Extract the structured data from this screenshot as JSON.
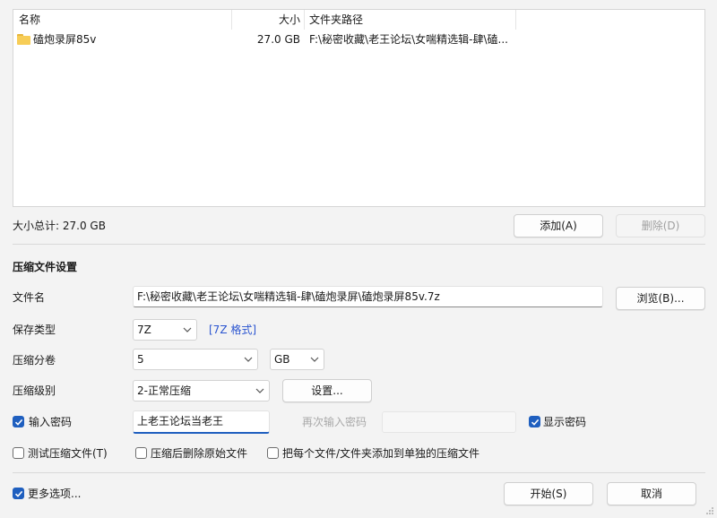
{
  "file_list": {
    "columns": {
      "name": "名称",
      "size": "大小",
      "path": "文件夹路径"
    },
    "rows": [
      {
        "icon": "folder-icon",
        "name": "磕炮录屏85v",
        "size": "27.0 GB",
        "path": "F:\\秘密收藏\\老王论坛\\女喘精选辑-肆\\磕..."
      }
    ]
  },
  "summary": {
    "total_size": "大小总计: 27.0 GB"
  },
  "buttons": {
    "add": "添加(A)",
    "delete": "删除(D)",
    "browse": "浏览(B)...",
    "settings": "设置...",
    "start": "开始(S)",
    "cancel": "取消"
  },
  "settings": {
    "section_title": "压缩文件设置",
    "filename_label": "文件名",
    "filename_value": "F:\\秘密收藏\\老王论坛\\女喘精选辑-肆\\磕炮录屏\\磕炮录屏85v.7z",
    "save_type_label": "保存类型",
    "save_type_value": "7Z",
    "format_hint": "[7Z 格式]",
    "split_label": "压缩分卷",
    "split_value": "5",
    "split_unit": "GB",
    "level_label": "压缩级别",
    "level_value": "2-正常压缩",
    "password_label": "输入密码",
    "password_checked": true,
    "password_value": "上老王论坛当老王",
    "password_confirm_placeholder": "再次输入密码",
    "show_password_label": "显示密码",
    "show_password_checked": true
  },
  "options": {
    "test_archive": {
      "label": "测试压缩文件(T)",
      "checked": false
    },
    "delete_after": {
      "label": "压缩后删除原始文件",
      "checked": false
    },
    "separate_archives": {
      "label": "把每个文件/文件夹添加到单独的压缩文件",
      "checked": false
    },
    "more_options": {
      "label": "更多选项...",
      "checked": true
    }
  },
  "colors": {
    "accent": "#1f5fbf",
    "link": "#2b55d0",
    "folder": "#f7cd57"
  }
}
